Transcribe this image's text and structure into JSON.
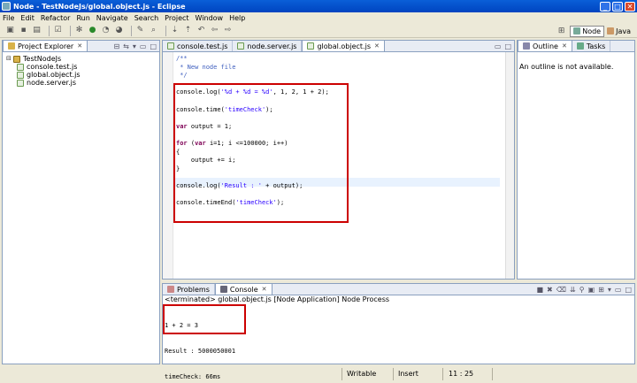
{
  "window": {
    "title": "Node - TestNodeJs/global.object.js - Eclipse",
    "minimize": "_",
    "maximize": "□",
    "close": "✕"
  },
  "menu": [
    "File",
    "Edit",
    "Refactor",
    "Run",
    "Navigate",
    "Search",
    "Project",
    "Window",
    "Help"
  ],
  "perspectives": [
    {
      "label": "Node",
      "active": true
    },
    {
      "label": "Java",
      "active": false
    }
  ],
  "explorer": {
    "tab_label": "Project Explorer",
    "project": "TestNodeJs",
    "files": [
      "console.test.js",
      "global.object.js",
      "node.server.js"
    ],
    "selected": "global.object.js"
  },
  "editor": {
    "tabs": [
      {
        "label": "console.test.js",
        "active": false
      },
      {
        "label": "node.server.js",
        "active": false
      },
      {
        "label": "global.object.js",
        "active": true
      }
    ],
    "lines": [
      {
        "cls": "cm",
        "text": "/**"
      },
      {
        "cls": "cm",
        "text": " * New node file"
      },
      {
        "cls": "cm",
        "text": " */"
      },
      {
        "cls": "",
        "text": ""
      },
      {
        "cls": "",
        "text": "console.log('%d + %d = %d', 1, 2, 1 + 2);"
      },
      {
        "cls": "",
        "text": ""
      },
      {
        "cls": "",
        "text": "console.time('timeCheck');"
      },
      {
        "cls": "",
        "text": ""
      },
      {
        "cls": "",
        "text": "var output = 1;"
      },
      {
        "cls": "",
        "text": ""
      },
      {
        "cls": "",
        "text": "for (var i=1; i <=100000; i++)"
      },
      {
        "cls": "",
        "text": "{"
      },
      {
        "cls": "",
        "text": "    output += i;"
      },
      {
        "cls": "",
        "text": "}"
      },
      {
        "cls": "",
        "text": ""
      },
      {
        "cls": "",
        "text": "console.log('Result : ' + output);"
      },
      {
        "cls": "",
        "text": ""
      },
      {
        "cls": "",
        "text": "console.timeEnd('timeCheck');"
      }
    ]
  },
  "outline": {
    "tabs": [
      {
        "label": "Outline",
        "active": true
      },
      {
        "label": "Tasks",
        "active": false
      }
    ],
    "message": "An outline is not available."
  },
  "console": {
    "tabs": [
      {
        "label": "Problems",
        "active": false
      },
      {
        "label": "Console",
        "active": true
      }
    ],
    "header": "<terminated> global.object.js [Node Application] Node Process",
    "output": [
      "1 + 2 = 3",
      "Result : 5000050001",
      "timeCheck: 66ms"
    ]
  },
  "status": {
    "mode": "Writable",
    "insert": "Insert",
    "position": "11 : 25"
  },
  "colors": {
    "annotation_box": "#cc0000",
    "titlebar": "#0a5fd8"
  }
}
